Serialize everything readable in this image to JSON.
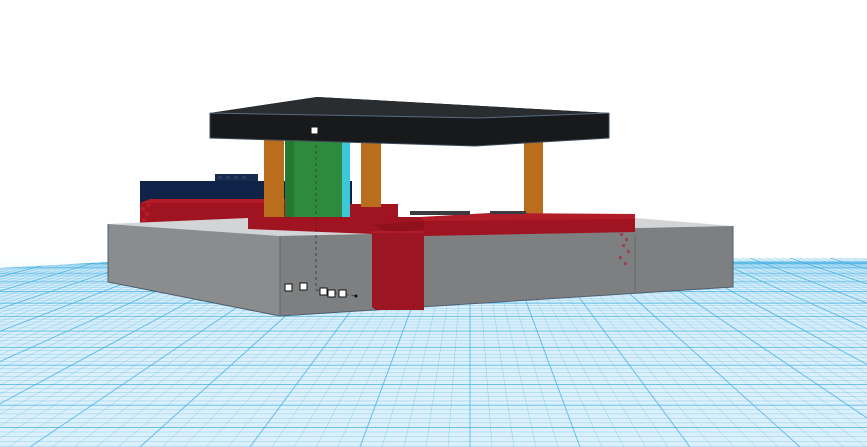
{
  "viewport": {
    "label": "",
    "background_color": "#ffffff",
    "grid_color": "#33a9df",
    "grid_fill_color": "#dcf0fb"
  },
  "scene": {
    "objects": [
      {
        "id": "workplane",
        "role": "grid"
      },
      {
        "id": "base-block",
        "color": "#7d7f80"
      },
      {
        "id": "base-top",
        "color": "#d2d4d6"
      },
      {
        "id": "red-border-front",
        "color": "#a01320"
      },
      {
        "id": "red-border-right",
        "color": "#a01320"
      },
      {
        "id": "red-border-left",
        "color": "#a01320"
      },
      {
        "id": "red-corner-post",
        "color": "#8e111c"
      },
      {
        "id": "navy-wall",
        "color": "#0f2247"
      },
      {
        "id": "green-column",
        "color": "#2e8b3d"
      },
      {
        "id": "orange-post-1",
        "color": "#b96d1d"
      },
      {
        "id": "orange-post-2",
        "color": "#b96d1d"
      },
      {
        "id": "orange-post-3",
        "color": "#b96d1d"
      },
      {
        "id": "black-roof",
        "color": "#17191b"
      }
    ],
    "selection_handles": 7
  }
}
